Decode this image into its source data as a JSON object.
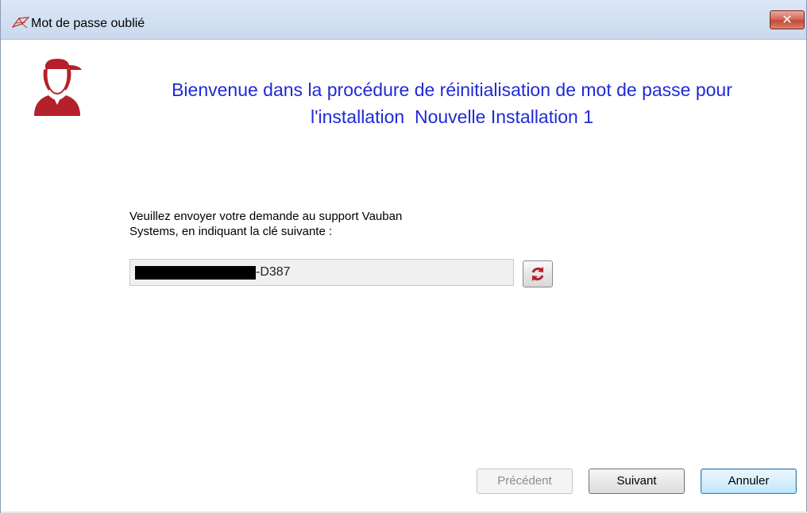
{
  "window": {
    "title": "Mot de passe oublié"
  },
  "titlebar": {
    "close_label": "✕"
  },
  "main": {
    "welcome_line1": "Bienvenue dans la procédure de réinitialisation de mot de passe pour",
    "welcome_line2": "l'installation  Nouvelle Installation 1",
    "instructions_line1": "Veuillez envoyer votre demande au support Vauban",
    "instructions_line2": "Systems, en indiquant la clé suivante :",
    "key_suffix": "-D387"
  },
  "buttons": {
    "previous_label": "Précédent",
    "next_label": "Suivant",
    "cancel_label": "Annuler"
  },
  "icons": {
    "app": "vauban-logo-icon",
    "avatar": "user-cap-icon",
    "refresh": "refresh-icon",
    "close": "close-icon"
  },
  "colors": {
    "welcome_text": "#1f2ad6",
    "avatar": "#b5202a",
    "close_button": "#c24a36"
  }
}
